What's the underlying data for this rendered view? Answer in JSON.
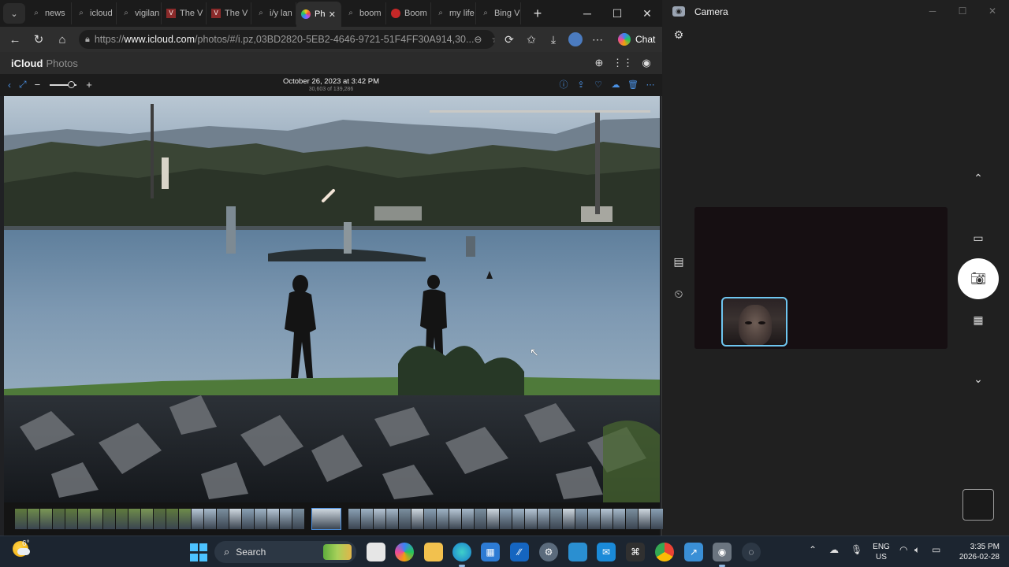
{
  "browser": {
    "tabs": [
      {
        "label": "news",
        "icon": "search-icon"
      },
      {
        "label": "icloud",
        "icon": "search-icon"
      },
      {
        "label": "vigilan",
        "icon": "search-icon"
      },
      {
        "label": "The V",
        "icon": "site-icon"
      },
      {
        "label": "The V",
        "icon": "site-icon"
      },
      {
        "label": "i/y lan",
        "icon": "search-icon"
      },
      {
        "label": "Ph",
        "icon": "photos-icon",
        "active": true
      },
      {
        "label": "boom",
        "icon": "search-icon"
      },
      {
        "label": "Boom",
        "icon": "site-icon"
      },
      {
        "label": "my life",
        "icon": "search-icon"
      },
      {
        "label": "Bing V",
        "icon": "search-icon"
      }
    ],
    "url_prefix": "https://",
    "url_host": "www.icloud.com",
    "url_rest": "/photos/#/i.pz,03BD2820-5EB2-4646-9721-51F4FF30A914,30...",
    "chat_label": "Chat"
  },
  "icloud": {
    "logo": "iCloud",
    "section": "Photos"
  },
  "viewer": {
    "date": "October 26, 2023 at 3:42 PM",
    "count": "30,603 of 139,286"
  },
  "camera": {
    "title": "Camera"
  },
  "taskbar": {
    "temperature": "6°",
    "search_label": "Search",
    "lang_1": "ENG",
    "lang_2": "US",
    "time": "3:35 PM",
    "date": "2026-02-28"
  },
  "colors": {
    "accent_blue": "#4a90e2",
    "camera_selection": "#6ec6f0",
    "taskbar_bg": "#1c2530"
  }
}
